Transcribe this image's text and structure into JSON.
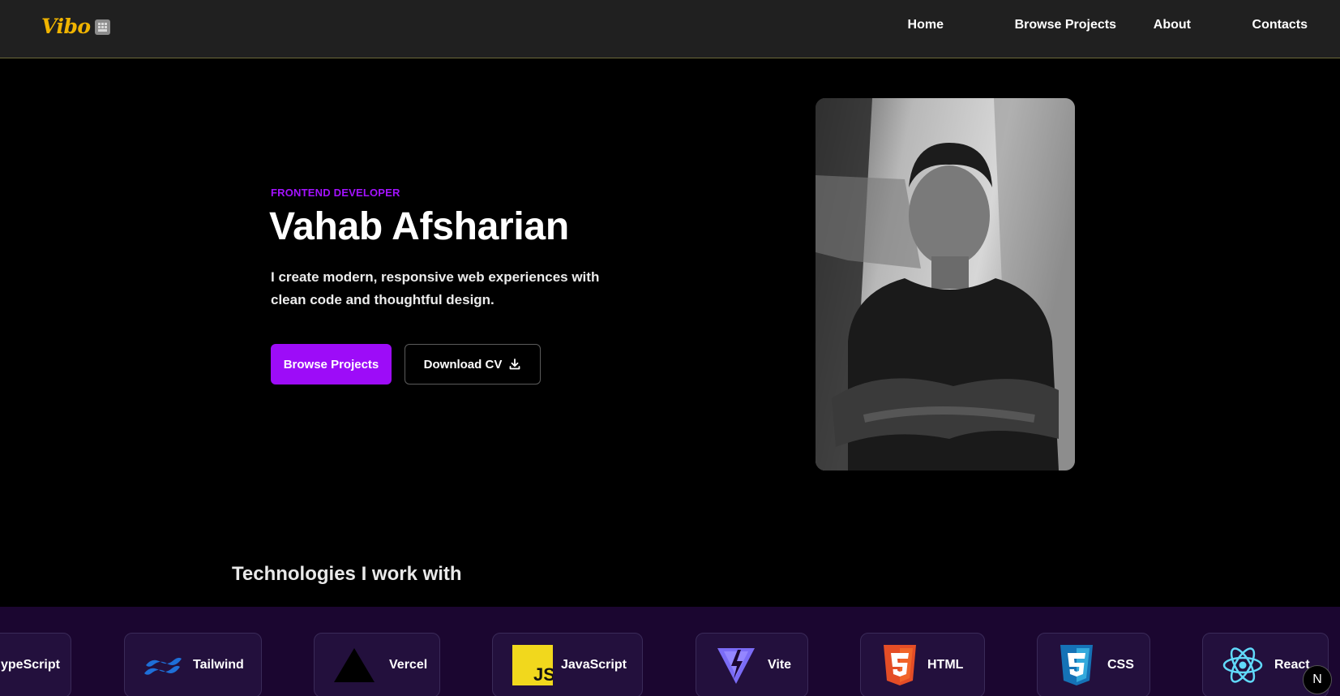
{
  "header": {
    "logo_text": "Vibo",
    "logo_badge_icon": "keyboard-icon",
    "nav": [
      {
        "label": "Home"
      },
      {
        "label": "Browse Projects"
      },
      {
        "label": "About"
      },
      {
        "label": "Contacts"
      }
    ]
  },
  "hero": {
    "eyebrow": "FRONTEND DEVELOPER",
    "name": "Vahab Afsharian",
    "tagline": "I create modern, responsive web experiences with clean code and thoughtful design.",
    "primary_button": "Browse Projects",
    "secondary_button": "Download CV",
    "secondary_icon": "download-icon",
    "accent_color": "#9d0cf8",
    "portrait_alt": "portrait-photo"
  },
  "technologies": {
    "title": "Technologies I work with",
    "items": [
      {
        "label": "ypeScript",
        "icon": "typescript-icon"
      },
      {
        "label": "Tailwind",
        "icon": "tailwind-icon"
      },
      {
        "label": "Vercel",
        "icon": "vercel-icon"
      },
      {
        "label": "JavaScript",
        "icon": "javascript-icon"
      },
      {
        "label": "Vite",
        "icon": "vite-icon"
      },
      {
        "label": "HTML",
        "icon": "html5-icon"
      },
      {
        "label": "CSS",
        "icon": "css3-icon"
      },
      {
        "label": "React",
        "icon": "react-icon"
      }
    ]
  },
  "dev_badge": {
    "label": "N",
    "icon": "nextjs-icon"
  }
}
